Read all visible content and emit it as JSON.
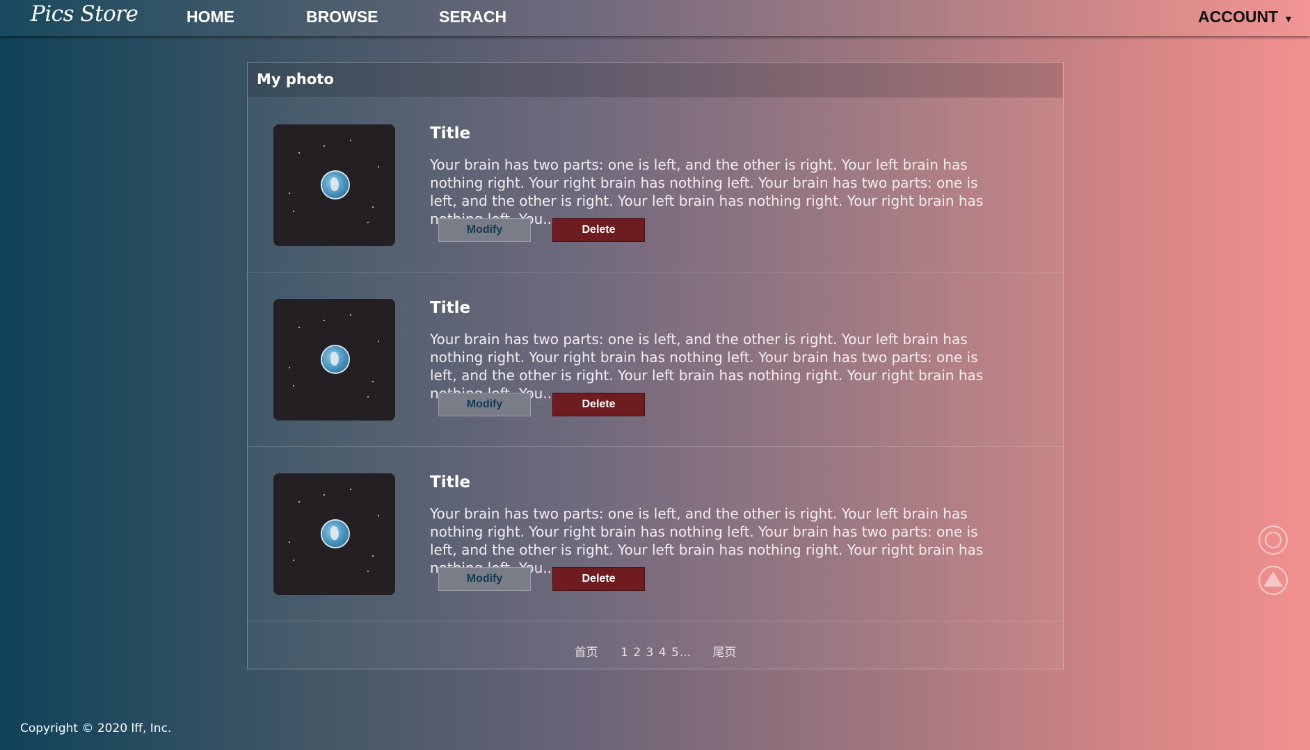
{
  "header": {
    "logo": "Pics Store",
    "nav": [
      {
        "label": "HOME"
      },
      {
        "label": "BROWSE"
      },
      {
        "label": "SERACH"
      }
    ],
    "account_label": "ACCOUNT",
    "account_caret": "▼"
  },
  "panel": {
    "title": "My photo",
    "items": [
      {
        "title": "Title",
        "description": "Your brain has two parts: one is left, and the other is right. Your left brain has nothing right. Your right brain has nothing left. Your brain has two parts: one is left, and the other is right. Your left brain has nothing right. Your right brain has nothing left. You...",
        "modify_label": "Modify",
        "delete_label": "Delete"
      },
      {
        "title": "Title",
        "description": "Your brain has two parts: one is left, and the other is right. Your left brain has nothing right. Your right brain has nothing left. Your brain has two parts: one is left, and the other is right. Your left brain has nothing right. Your right brain has nothing left. You...",
        "modify_label": "Modify",
        "delete_label": "Delete"
      },
      {
        "title": "Title",
        "description": "Your brain has two parts: one is left, and the other is right. Your left brain has nothing right. Your right brain has nothing left. Your brain has two parts: one is left, and the other is right. Your left brain has nothing right. Your right brain has nothing left. You...",
        "modify_label": "Modify",
        "delete_label": "Delete"
      }
    ],
    "pagination": {
      "first": "首页",
      "pages": [
        "1",
        "2",
        "3",
        "4",
        "5"
      ],
      "ellipsis": "...",
      "last": "尾页"
    }
  },
  "side_buttons": [
    {
      "icon": "refresh-icon"
    },
    {
      "icon": "back-to-top-icon"
    }
  ],
  "footer": {
    "copyright": "Copyright © 2020 lff, Inc."
  },
  "colors": {
    "delete_button": "#6e1c20",
    "modify_button": "#7a7c88",
    "gradient_left": "#0f4258",
    "gradient_right": "#f29190"
  }
}
